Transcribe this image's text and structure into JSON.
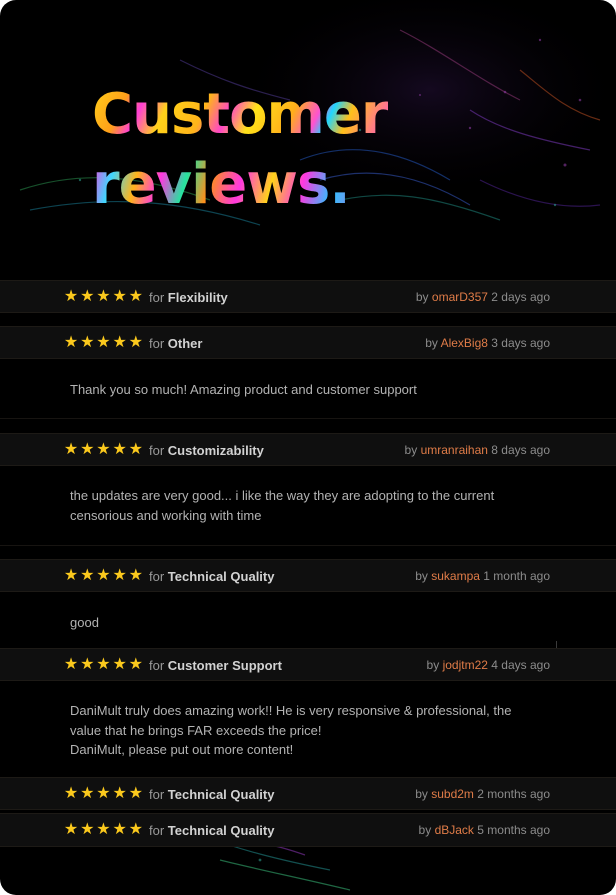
{
  "hero": {
    "title_line1": "Customer",
    "title_line2": "reviews."
  },
  "rating_icon": "star-icon",
  "colors": {
    "star": "#fbc91d",
    "author": "#e07c48",
    "background": "#000000",
    "row": "#0f0f0f"
  },
  "reviews": [
    {
      "stars": 5,
      "for_label": "for",
      "category": "Flexibility",
      "by_label": "by",
      "author": "omarD357",
      "time": "2 days ago",
      "body": []
    },
    {
      "stars": 5,
      "for_label": "for",
      "category": "Other",
      "by_label": "by",
      "author": "AlexBig8",
      "time": "3 days ago",
      "body": [
        "Thank you so much! Amazing product and customer support"
      ]
    },
    {
      "stars": 5,
      "for_label": "for",
      "category": "Customizability",
      "by_label": "by",
      "author": "umranraihan",
      "time": "8 days ago",
      "body": [
        "the updates are very good... i like the way they are adopting to the current",
        "censorious and working with time"
      ]
    },
    {
      "stars": 5,
      "for_label": "for",
      "category": "Technical Quality",
      "by_label": "by",
      "author": "sukampa",
      "time": "1 month ago",
      "body": [
        "good"
      ]
    },
    {
      "stars": 5,
      "for_label": "for",
      "category": "Customer Support",
      "by_label": "by",
      "author": "jodjtm22",
      "time": "4 days ago",
      "body": [
        "DaniMult truly does amazing work!! He is very responsive & professional, the",
        "value that he brings FAR exceeds the price!",
        "DaniMult, please put out more content!"
      ]
    },
    {
      "stars": 5,
      "for_label": "for",
      "category": "Technical Quality",
      "by_label": "by",
      "author": "subd2m",
      "time": "2 months ago",
      "body": []
    },
    {
      "stars": 5,
      "for_label": "for",
      "category": "Technical Quality",
      "by_label": "by",
      "author": "dBJack",
      "time": "5 months ago",
      "body": []
    }
  ]
}
